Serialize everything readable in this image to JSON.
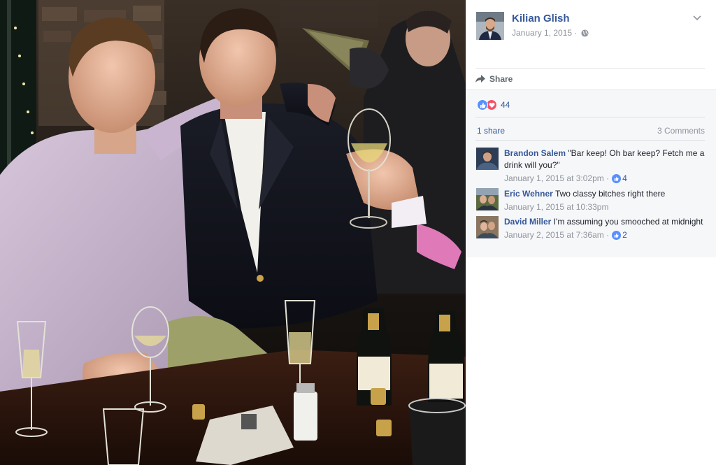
{
  "post": {
    "author": "Kilian Glish",
    "date": "January 1, 2015",
    "separator": " · "
  },
  "actions": {
    "share_label": "Share"
  },
  "stats": {
    "reaction_count": "44",
    "shares_label": "1 share",
    "comments_label": "3 Comments"
  },
  "comments": [
    {
      "author": "Brandon Salem",
      "text": "\"Bar keep! Oh bar keep? Fetch me a drink will you?\"",
      "timestamp": "January 1, 2015 at 3:02pm",
      "likes": "4"
    },
    {
      "author": "Eric Wehner",
      "text": "Two classy bitches right there",
      "timestamp": "January 1, 2015 at 10:33pm",
      "likes": ""
    },
    {
      "author": "David Miller",
      "text": "I'm assuming you smooched at midnight",
      "timestamp": "January 2, 2015 at 7:36am",
      "likes": "2"
    }
  ],
  "icons": {
    "chevron": "chevron-down-icon",
    "globe": "globe-icon",
    "share": "share-arrow-icon",
    "like": "like-reaction-icon",
    "love": "love-reaction-icon"
  },
  "colors": {
    "link": "#365899",
    "meta": "#90949c",
    "like": "#5890ff",
    "love": "#f25268",
    "panel_gray": "#f6f7f9"
  }
}
